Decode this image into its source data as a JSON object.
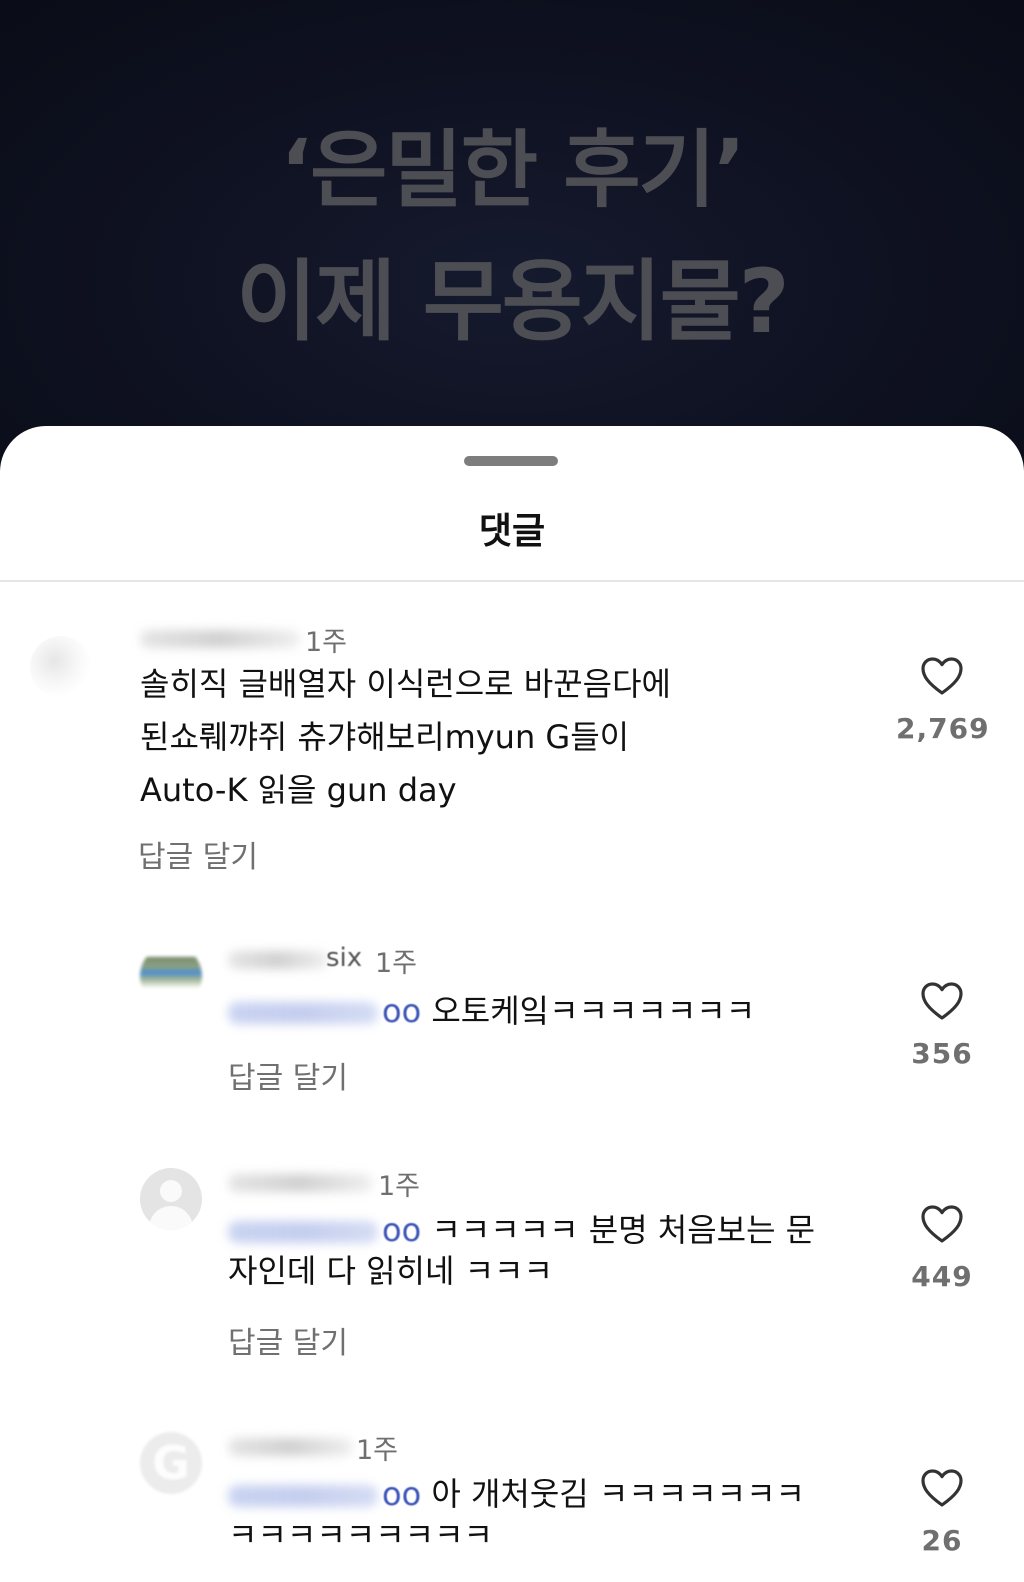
{
  "banner": {
    "line1": "‘은밀한 후기’",
    "line2": "이제 무용지물?"
  },
  "sheet": {
    "title": "댓글"
  },
  "comments": [
    {
      "time": "1주",
      "lines": [
        "솔히직 글배열자 이식런으로 바꾼음다에",
        "된쇼뤠꺄쥐 츄갸해보리myun G들이",
        "Auto-K 읽을 gun day"
      ],
      "reply": "답글 달기",
      "likes": "2,769"
    },
    {
      "username_fragment": "six",
      "time": "1주",
      "mention_fragment": "oo",
      "lines": [
        "오토케잌ㅋㅋㅋㅋㅋㅋㅋ"
      ],
      "reply": "답글 달기",
      "likes": "356"
    },
    {
      "time": "1주",
      "mention_fragment": "oo",
      "lines": [
        "ㅋㅋㅋㅋㅋ 분명 처음보는 문",
        "자인데 다 읽히네 ㅋㅋㅋ"
      ],
      "reply": "답글 달기",
      "likes": "449"
    },
    {
      "time": "1주",
      "mention_fragment": "oo",
      "lines": [
        "아 개처웃김 ㅋㅋㅋㅋㅋㅋㅋ",
        "ㅋㅋㅋㅋㅋㅋㅋㅋㅋ"
      ],
      "likes": "26"
    }
  ],
  "icons": {
    "like": "heart-outline-icon",
    "avatar_default": "default-avatar-icon"
  },
  "colors": {
    "banner_bg": "#0e1120",
    "banner_text": "#4d4e54",
    "secondary_text": "#6f6f6f",
    "mention": "#3d55b8"
  }
}
